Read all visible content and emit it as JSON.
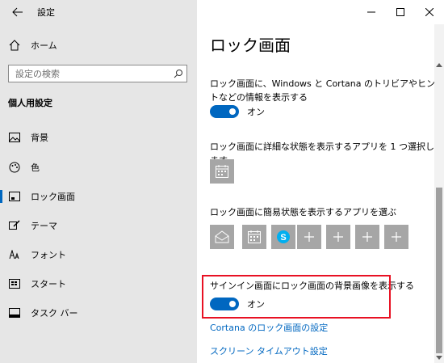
{
  "window": {
    "app_title": "設定",
    "minimize_icon": "minimize-icon",
    "maximize_icon": "maximize-icon",
    "close_icon": "close-icon"
  },
  "sidebar": {
    "home_label": "ホーム",
    "search_placeholder": "設定の検索",
    "section_heading": "個人用設定",
    "items": [
      {
        "label": "背景",
        "icon": "picture-icon"
      },
      {
        "label": "色",
        "icon": "palette-icon"
      },
      {
        "label": "ロック画面",
        "icon": "lock-screen-icon",
        "selected": true
      },
      {
        "label": "テーマ",
        "icon": "brush-icon"
      },
      {
        "label": "フォント",
        "icon": "font-icon"
      },
      {
        "label": "スタート",
        "icon": "start-icon"
      },
      {
        "label": "タスク バー",
        "icon": "taskbar-icon"
      }
    ]
  },
  "main": {
    "title": "ロック画面",
    "setting1": {
      "text": "ロック画面に、Windows と Cortana のトリビアやヒントなどの情報を表示する",
      "toggle_state": "オン"
    },
    "setting2": {
      "text": "ロック画面に詳細な状態を表示するアプリを 1 つ選択します"
    },
    "setting3": {
      "text": "ロック画面に簡易状態を表示するアプリを選ぶ",
      "tiles": [
        "mail-icon",
        "calendar-icon",
        "skype-icon",
        "plus-icon",
        "plus-icon",
        "plus-icon",
        "plus-icon"
      ]
    },
    "setting4": {
      "text": "サインイン画面にロック画面の背景画像を表示する",
      "toggle_state": "オン"
    },
    "links": {
      "cortana": "Cortana のロック画面の設定",
      "timeout": "スクリーン タイムアウト設定"
    }
  },
  "colors": {
    "accent": "#0067c0",
    "highlight_border": "#e81123",
    "tile_bg": "#a6a6a6"
  }
}
